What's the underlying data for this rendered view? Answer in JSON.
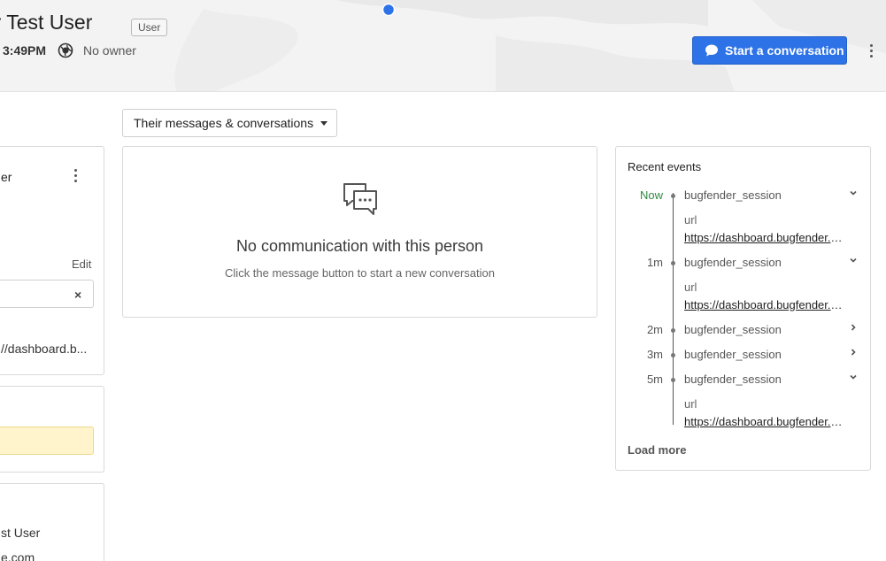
{
  "header": {
    "user_name": "der Test User",
    "user_type_badge": "User",
    "local_time": "3:49PM",
    "owner": "No owner",
    "start_conversation_label": "Start a conversation",
    "accent_color": "#2d72e6"
  },
  "left_panel": {
    "card1_title": "er",
    "edit_label": "Edit",
    "clear_icon": "×",
    "url_value": "//dashboard.b...",
    "card3_name": "st User",
    "card3_email": "e.com"
  },
  "filter": {
    "selected_label": "Their messages & conversations"
  },
  "empty_state": {
    "title": "No communication with this person",
    "subtitle": "Click the message button to start a new conversation"
  },
  "recent_events": {
    "title": "Recent events",
    "load_more_label": "Load more",
    "items": [
      {
        "time": "Now",
        "name": "bugfender_session",
        "expanded": true,
        "key": "url",
        "value": "https://dashboard.bugfender.com/"
      },
      {
        "time": "1m",
        "name": "bugfender_session",
        "expanded": true,
        "key": "url",
        "value": "https://dashboard.bugfender.com/"
      },
      {
        "time": "2m",
        "name": "bugfender_session",
        "expanded": false
      },
      {
        "time": "3m",
        "name": "bugfender_session",
        "expanded": false
      },
      {
        "time": "5m",
        "name": "bugfender_session",
        "expanded": true,
        "key": "url",
        "value": "https://dashboard.bugfender.com/"
      }
    ]
  }
}
